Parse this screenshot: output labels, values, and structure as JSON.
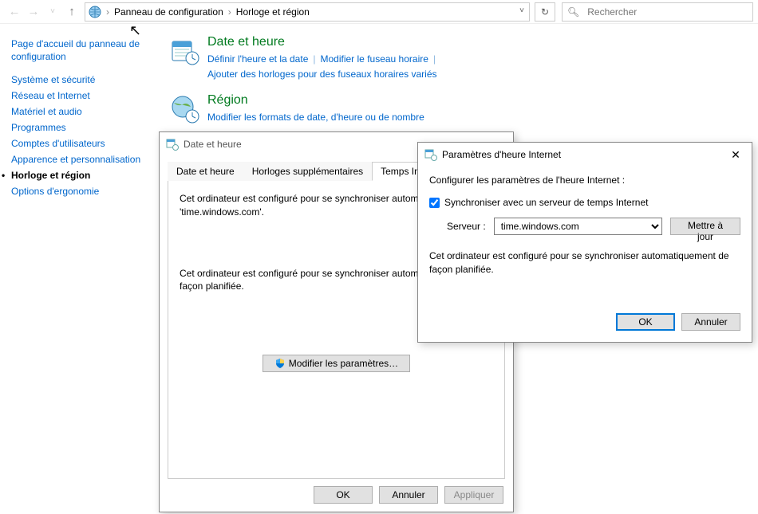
{
  "breadcrumb": {
    "root": "Panneau de configuration",
    "leaf": "Horloge et région"
  },
  "search": {
    "placeholder": "Rechercher"
  },
  "sidebar": {
    "home": "Page d'accueil du panneau de configuration",
    "items": [
      "Système et sécurité",
      "Réseau et Internet",
      "Matériel et audio",
      "Programmes",
      "Comptes d'utilisateurs",
      "Apparence et personnalisation",
      "Horloge et région",
      "Options d'ergonomie"
    ],
    "activeIndex": 6
  },
  "content": {
    "cat1_title": "Date et heure",
    "cat1_sub1": "Définir l'heure et la date",
    "cat1_sub2": "Modifier le fuseau horaire",
    "cat1_sub3": "Ajouter des horloges pour des fuseaux horaires variés",
    "cat2_title": "Région",
    "cat2_sub1": "Modifier les formats de date, d'heure ou de nombre"
  },
  "dlg1": {
    "title": "Date et heure",
    "tab1": "Date et heure",
    "tab2": "Horloges supplémentaires",
    "tab3": "Temps Internet",
    "msg1": "Cet ordinateur est configuré pour se synchroniser automatiquement avec 'time.windows.com'.",
    "msg2": "Cet ordinateur est configuré pour se synchroniser automatiquement de façon planifiée.",
    "modbtn": "Modifier les paramètres…",
    "ok": "OK",
    "cancel": "Annuler",
    "apply": "Appliquer"
  },
  "dlg2": {
    "title": "Paramètres d'heure Internet",
    "line1": "Configurer les paramètres de l'heure Internet :",
    "chk": "Synchroniser avec un serveur de temps Internet",
    "server_label": "Serveur :",
    "server_value": "time.windows.com",
    "update": "Mettre à jour",
    "desc": "Cet ordinateur est configuré pour se synchroniser automatiquement de façon planifiée.",
    "ok": "OK",
    "cancel": "Annuler"
  }
}
